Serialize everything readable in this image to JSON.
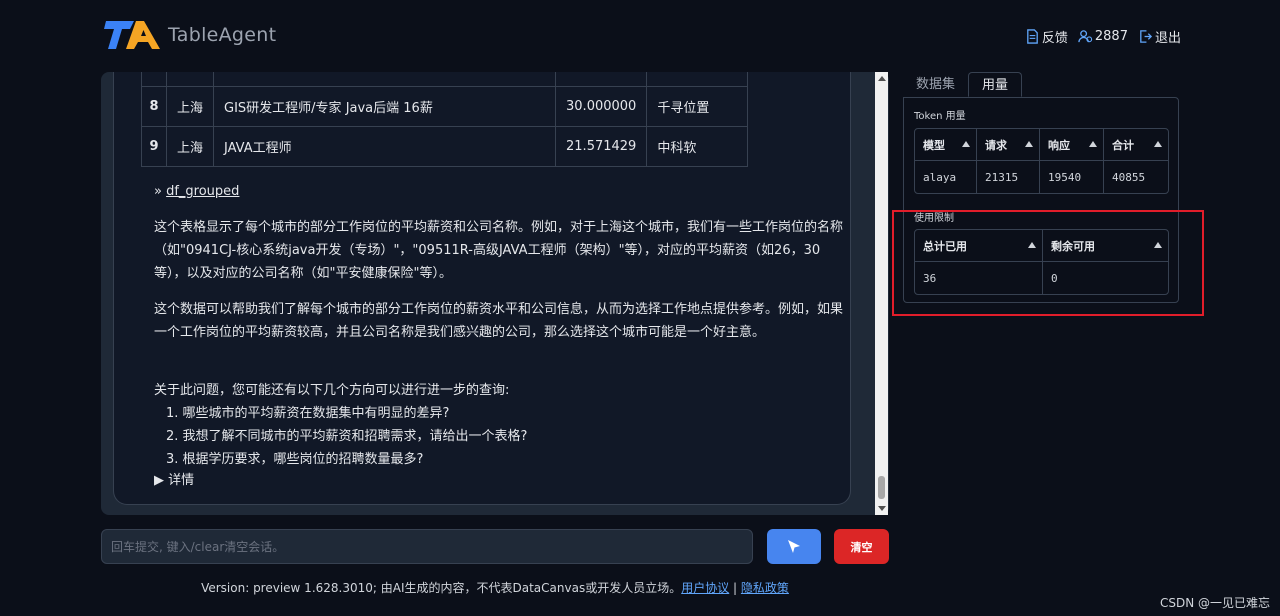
{
  "header": {
    "logo_text": "TableAgent",
    "feedback_label": "反馈",
    "count_label": "2887",
    "logout_label": "退出"
  },
  "table": {
    "partial_row": [
      "",
      "",
      "",
      "",
      ""
    ],
    "rows": [
      {
        "idx": "8",
        "city": "上海",
        "job": "GIS研发工程师/专家 Java后端 16薪",
        "salary": "30.000000",
        "company": "千寻位置"
      },
      {
        "idx": "9",
        "city": "上海",
        "job": "JAVA工程师",
        "salary": "21.571429",
        "company": "中科软"
      }
    ]
  },
  "chat": {
    "link_prefix": "» ",
    "link_text": "df_grouped",
    "para1": "这个表格显示了每个城市的部分工作岗位的平均薪资和公司名称。例如，对于上海这个城市，我们有一些工作岗位的名称（如\"0941CJ-核心系统java开发（专场）\"，\"09511R-高级JAVA工程师（架构）\"等），对应的平均薪资（如26，30等），以及对应的公司名称（如\"平安健康保险\"等）。",
    "para2": "这个数据可以帮助我们了解每个城市的部分工作岗位的薪资水平和公司信息，从而为选择工作地点提供参考。例如，如果一个工作岗位的平均薪资较高，并且公司名称是我们感兴趣的公司，那么选择这个城市可能是一个好主意。",
    "suggest_intro": "关于此问题，您可能还有以下几个方向可以进行进一步的查询:",
    "suggestions": [
      "1. 哪些城市的平均薪资在数据集中有明显的差异?",
      "2. 我想了解不同城市的平均薪资和招聘需求，请给出一个表格?",
      "3. 根据学历要求，哪些岗位的招聘数量最多?"
    ],
    "details_label": "▶ 详情"
  },
  "input": {
    "placeholder": "回车提交, 键入/clear清空会话。",
    "clear_label": "清空"
  },
  "footer": {
    "text": "Version: preview 1.628.3010; 由AI生成的内容，不代表DataCanvas或开发人员立场。",
    "link1": "用户协议",
    "sep": " | ",
    "link2": "隐私政策"
  },
  "watermark": "CSDN @一见已难忘",
  "sidebar": {
    "tabs": [
      "数据集",
      "用量"
    ],
    "token_label": "Token 用量",
    "token_headers": [
      "模型",
      "请求",
      "响应",
      "合计"
    ],
    "token_row": [
      "alaya",
      "21315",
      "19540",
      "40855"
    ],
    "limit_label": "使用限制",
    "limit_headers": [
      "总计已用",
      "剩余可用"
    ],
    "limit_row": [
      "36",
      "0"
    ]
  },
  "colors": {
    "send_button": "#4785ef",
    "clear_button": "#dc2626",
    "highlight_box": "#e11d2a"
  }
}
